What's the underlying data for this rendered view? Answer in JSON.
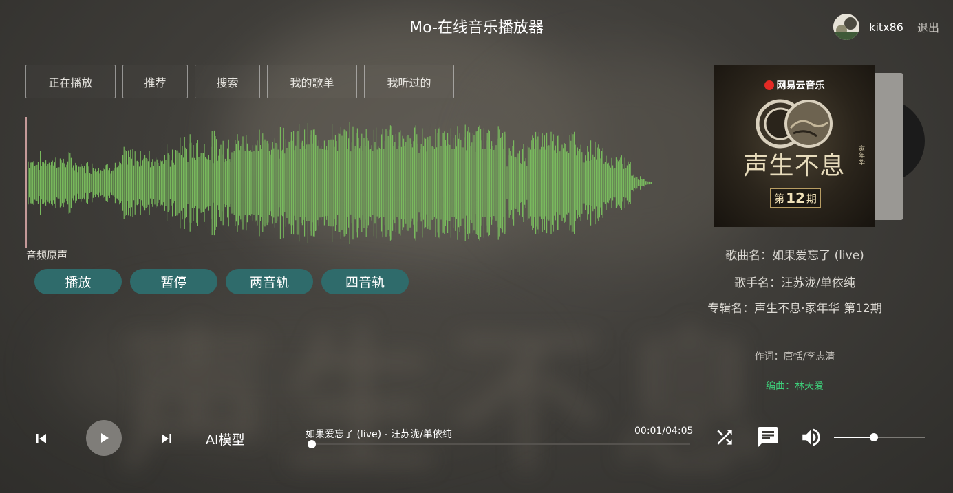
{
  "app": {
    "title": "Mo-在线音乐播放器"
  },
  "user": {
    "name": "kitx86",
    "logout_label": "退出"
  },
  "nav": {
    "tabs": [
      {
        "label": "正在播放"
      },
      {
        "label": "推荐"
      },
      {
        "label": "搜索"
      },
      {
        "label": "我的歌单"
      },
      {
        "label": "我听过的"
      }
    ]
  },
  "waveform": {
    "label": "音频原声",
    "color": "#7bbf5f",
    "cursor_color": "#f2b9b9"
  },
  "audio_controls": {
    "play_label": "播放",
    "pause_label": "暂停",
    "two_track_label": "两音轨",
    "four_track_label": "四音轨"
  },
  "cover": {
    "brand": "网易云音乐",
    "title": "声生不息",
    "subtitle": "家年华",
    "episode_prefix": "第",
    "episode_number": "12",
    "episode_suffix": "期"
  },
  "song_info": {
    "song": "歌曲名：如果爱忘了 (live)",
    "singer": "歌手名：汪苏泷/单依纯",
    "album": "专辑名：声生不息·家年华 第12期"
  },
  "lyrics": {
    "lines": [
      {
        "text": "作词：唐恬/李志清",
        "color": "#c9c6c0"
      },
      {
        "text": "编曲：林天爱",
        "color": "#3ecf7a"
      }
    ]
  },
  "player": {
    "ai_label": "AI模型",
    "now_playing": "如果爱忘了 (live) - 汪苏泷/单依纯",
    "time": "00:01/04:05",
    "progress_fraction": 0.004,
    "volume_fraction": 0.44
  },
  "icons": {
    "prev": "skip-previous-icon",
    "play": "play-icon",
    "next": "skip-next-icon",
    "shuffle": "shuffle-icon",
    "lyrics": "comment-icon",
    "volume": "volume-up-icon"
  }
}
